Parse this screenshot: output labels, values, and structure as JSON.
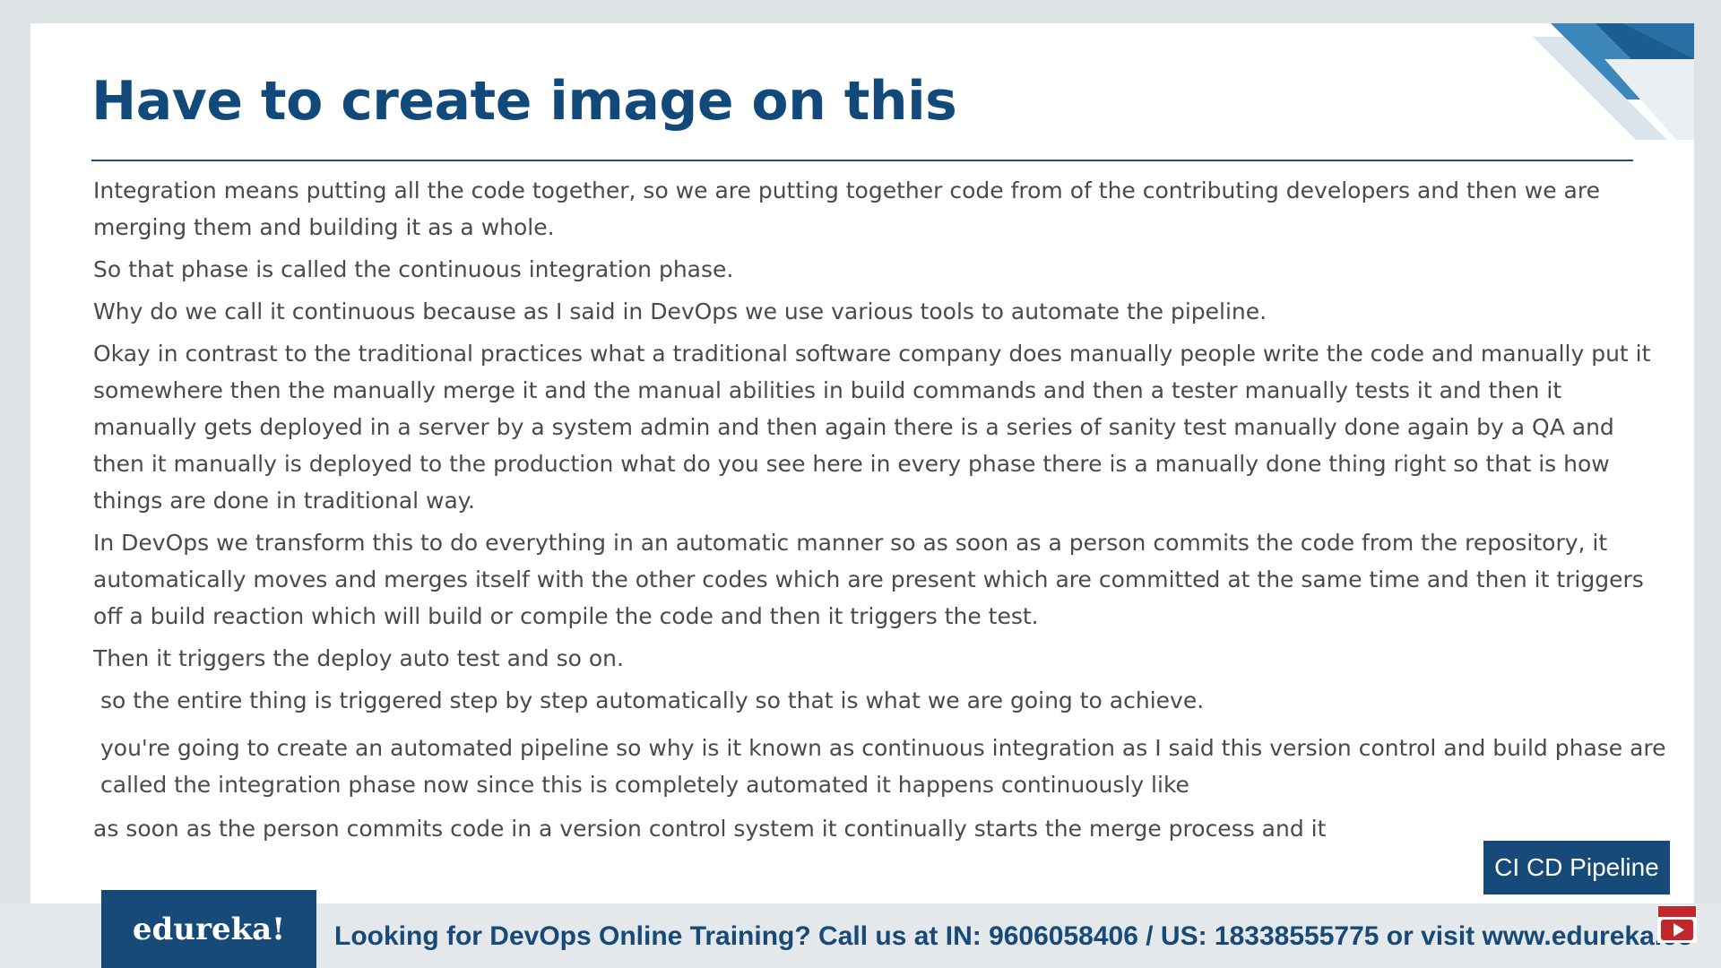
{
  "slide": {
    "title": "Have to create image on this",
    "paragraphs": [
      "Integration means putting all the code together, so we are putting together code from of the contributing developers  and then we are merging them and building it as a whole.",
      "So that phase is called the continuous integration phase.",
      "Why do we call it continuous because as I said in DevOps we use various tools to automate the pipeline.",
      "Okay in contrast to the traditional practices what a traditional software company does manually                    people write the code and manually put it       somewhere then the manually merge it and the manual abilities in build commands and then a  tester manually tests it and then it manually gets deployed in a server by a system admin and then again there is a  series of sanity test manually done again by a QA and then it manually is deployed to the production what do you see  here in every phase there is a manually done thing right so that is how things are done in traditional way.",
      "In DevOps we transform this to do everything in an automatic manner so as soon as a person commits the code from  the repository, it automatically moves and merges itself with the other codes which are present which are committed  at the same time and then it triggers off a build reaction which will build or compile the code and then it triggers the  test.",
      "Then it triggers the deploy auto test and so on.",
      " so the entire thing is triggered step by step automatically so that is what we are going to achieve.",
      " you're going to create an automated pipeline so why is it known as continuous integration as I said this version control and build phase are called the integration phase now since this is completely automated it happens continuously like",
      "as soon as     the person commits code in a version control system it continually starts the merge process and it"
    ],
    "badge": "CI CD Pipeline"
  },
  "footer": {
    "logo": "edureka!",
    "promo": "Looking for DevOps Online Training? Call us at IN: 9606058406 / US: 18338555775 or visit www.edureka.co"
  },
  "colors": {
    "title": "#114a7a",
    "brand": "#174a78",
    "body_text": "#4a4a4a",
    "footer_bg": "#e4e8eb"
  },
  "icons": {
    "corner": "corner-stripes-decoration",
    "subscribe": "subscribe-icon"
  }
}
